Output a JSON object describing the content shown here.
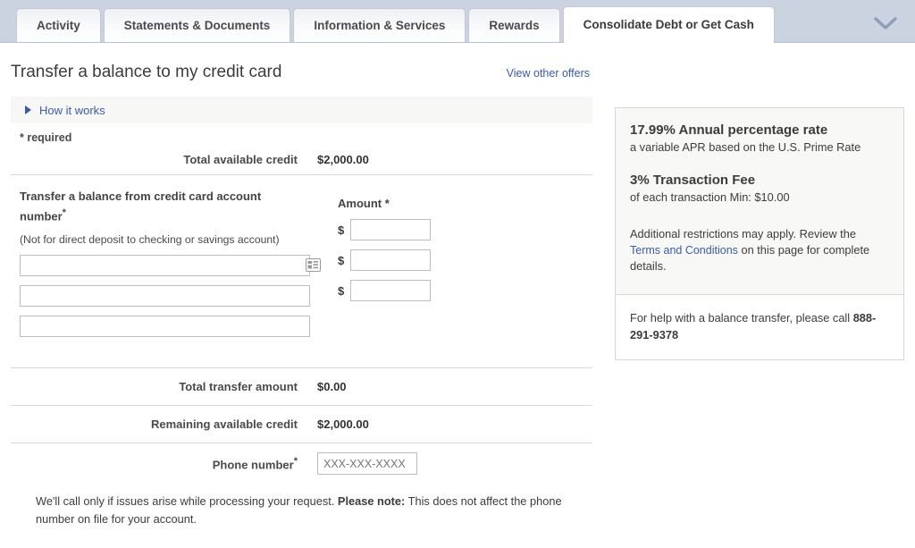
{
  "tabs": [
    {
      "label": "Activity",
      "active": false
    },
    {
      "label": "Statements & Documents",
      "active": false
    },
    {
      "label": "Information & Services",
      "active": false
    },
    {
      "label": "Rewards",
      "active": false
    },
    {
      "label": "Consolidate Debt or Get Cash",
      "active": true
    }
  ],
  "tabbar": {
    "expand_icon": "chevron-down-icon"
  },
  "main": {
    "page_title": "Transfer a balance to my credit card",
    "view_other_offers": "View other offers",
    "how_it_works": "How it works",
    "required_note": "* required",
    "total_available_credit_label": "Total available credit",
    "total_available_credit_value": "$2,000.00",
    "account_field_label": "Transfer a balance from credit card account number",
    "account_field_required_mark": "*",
    "account_subnote": "(Not for direct deposit to checking or savings account)",
    "amount_label": "Amount *",
    "account_rows": [
      {
        "account_value": "",
        "account_placeholder": "",
        "currency_symbol": "$",
        "amount_value": "",
        "amount_placeholder": "",
        "has_card_icon": true
      },
      {
        "account_value": "",
        "account_placeholder": "",
        "currency_symbol": "$",
        "amount_value": "",
        "amount_placeholder": "",
        "has_card_icon": false
      },
      {
        "account_value": "",
        "account_placeholder": "",
        "currency_symbol": "$",
        "amount_value": "",
        "amount_placeholder": "",
        "has_card_icon": false
      }
    ],
    "total_transfer_label": "Total transfer amount",
    "total_transfer_value": "$0.00",
    "remaining_credit_label": "Remaining available credit",
    "remaining_credit_value": "$2,000.00",
    "phone_label": "Phone number",
    "phone_required_mark": "*",
    "phone_value": "",
    "phone_placeholder": "XXX-XXX-XXXX",
    "disclaimer_part1": "We'll call only if issues arise while processing your request. ",
    "disclaimer_bold": "Please note:",
    "disclaimer_part2": " This does not affect the phone number on file for your account."
  },
  "offer_panel": {
    "apr_headline": "17.99% Annual percentage rate",
    "apr_sub": "a variable APR based on the U.S. Prime Rate",
    "fee_headline": "3% Transaction Fee",
    "fee_sub": "of each transaction Min: $10.00",
    "restrictions_part1": "Additional restrictions may apply. Review the ",
    "terms_link": "Terms and Conditions",
    "restrictions_part2": " on this page for complete details.",
    "help_text": "For help with a balance transfer, please call ",
    "help_phone": "888-291-9378"
  },
  "colors": {
    "tabbar_bg": "#ccd3e0",
    "link_blue": "#3c5aa8",
    "panel_bg": "#f8f8f6",
    "border_gray": "#d8d8d6",
    "text_dark": "#3c3c3c"
  }
}
